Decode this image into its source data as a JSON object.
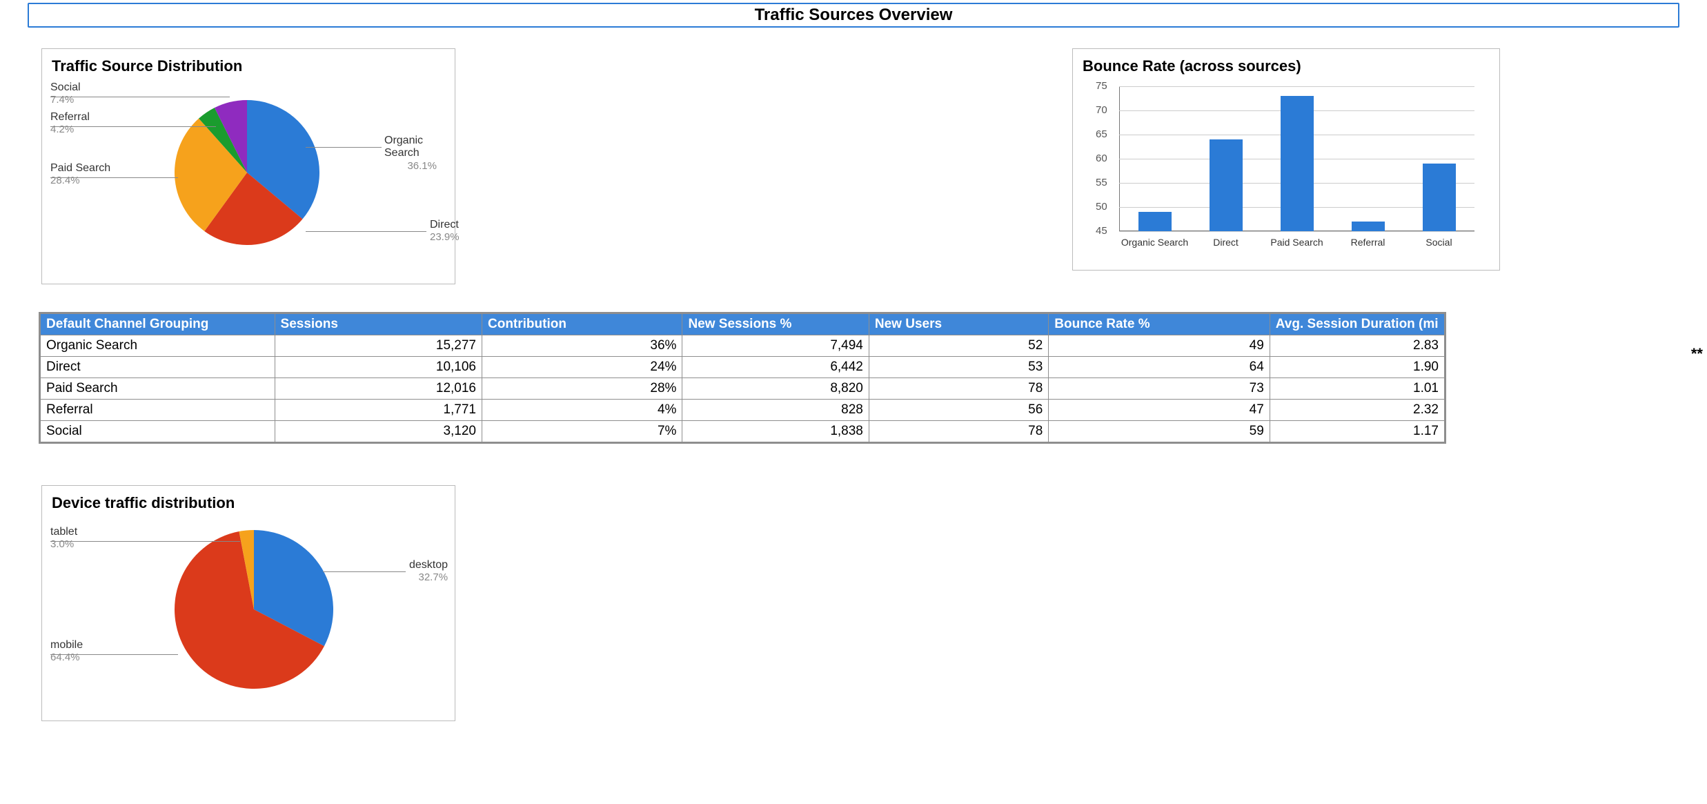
{
  "page": {
    "title": "Traffic Sources Overview"
  },
  "chart_data": [
    {
      "id": "traffic_source_pie",
      "type": "pie",
      "title": "Traffic Source Distribution",
      "slices": [
        {
          "label": "Organic Search",
          "value": 36.1,
          "display": "36.1%",
          "color": "#2b7bd6"
        },
        {
          "label": "Direct",
          "value": 23.9,
          "display": "23.9%",
          "color": "#db3a1b"
        },
        {
          "label": "Paid Search",
          "value": 28.4,
          "display": "28.4%",
          "color": "#f6a21c"
        },
        {
          "label": "Referral",
          "value": 4.2,
          "display": "4.2%",
          "color": "#1a9c2e"
        },
        {
          "label": "Social",
          "value": 7.4,
          "display": "7.4%",
          "color": "#8f2bbf"
        }
      ]
    },
    {
      "id": "bounce_rate_bar",
      "type": "bar",
      "title": "Bounce Rate (across sources)",
      "categories": [
        "Organic Search",
        "Direct",
        "Paid Search",
        "Referral",
        "Social"
      ],
      "values": [
        49,
        64,
        73,
        47,
        59
      ],
      "ylabel": "",
      "ylim": [
        45,
        75
      ],
      "yticks": [
        45,
        50,
        55,
        60,
        65,
        70,
        75
      ],
      "bar_color": "#2b7bd6"
    },
    {
      "id": "device_pie",
      "type": "pie",
      "title": "Device traffic distribution",
      "slices": [
        {
          "label": "desktop",
          "value": 32.7,
          "display": "32.7%",
          "color": "#2b7bd6"
        },
        {
          "label": "mobile",
          "value": 64.4,
          "display": "64.4%",
          "color": "#db3a1b"
        },
        {
          "label": "tablet",
          "value": 3.0,
          "display": "3.0%",
          "color": "#f6a21c"
        }
      ]
    }
  ],
  "table": {
    "headers": [
      "Default Channel Grouping",
      "Sessions",
      "Contribution",
      "New Sessions %",
      "New Users",
      "Bounce Rate %",
      "Avg. Session Duration (mi"
    ],
    "rows": [
      {
        "channel": "Organic Search",
        "sessions": "15,277",
        "contribution": "36%",
        "new_sessions": "7,494",
        "new_users": "52",
        "bounce": "49",
        "duration": "2.83"
      },
      {
        "channel": "Direct",
        "sessions": "10,106",
        "contribution": "24%",
        "new_sessions": "6,442",
        "new_users": "53",
        "bounce": "64",
        "duration": "1.90"
      },
      {
        "channel": "Paid Search",
        "sessions": "12,016",
        "contribution": "28%",
        "new_sessions": "8,820",
        "new_users": "78",
        "bounce": "73",
        "duration": "1.01"
      },
      {
        "channel": "Referral",
        "sessions": "1,771",
        "contribution": "4%",
        "new_sessions": "828",
        "new_users": "56",
        "bounce": "47",
        "duration": "2.32"
      },
      {
        "channel": "Social",
        "sessions": "3,120",
        "contribution": "7%",
        "new_sessions": "1,838",
        "new_users": "78",
        "bounce": "59",
        "duration": "1.17"
      }
    ]
  },
  "side_text": "**"
}
